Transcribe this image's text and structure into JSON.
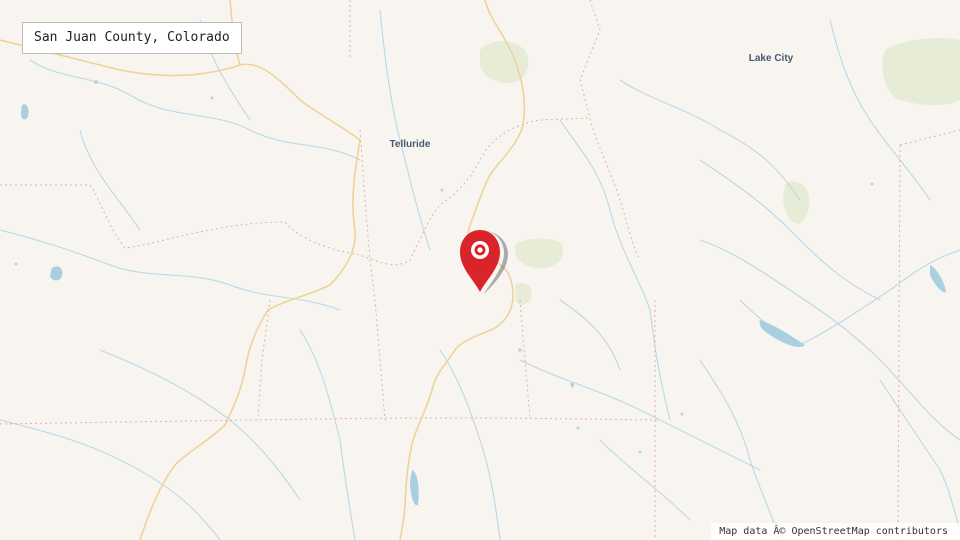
{
  "map": {
    "title": "San Juan County, Colorado",
    "places": [
      {
        "id": "telluride",
        "name": "Telluride"
      },
      {
        "id": "lake-city",
        "name": "Lake City"
      }
    ],
    "attribution": "Map data Â© OpenStreetMap contributors",
    "marker": {
      "icon": "map-pin-icon",
      "color": "#d9242b"
    },
    "colors": {
      "land": "#f8f5f1",
      "water": "#a9d0e0",
      "road": "#f1cf90",
      "boundary": "#dfa8a8",
      "forest": "#e2ead0",
      "label": "#47596f"
    }
  }
}
